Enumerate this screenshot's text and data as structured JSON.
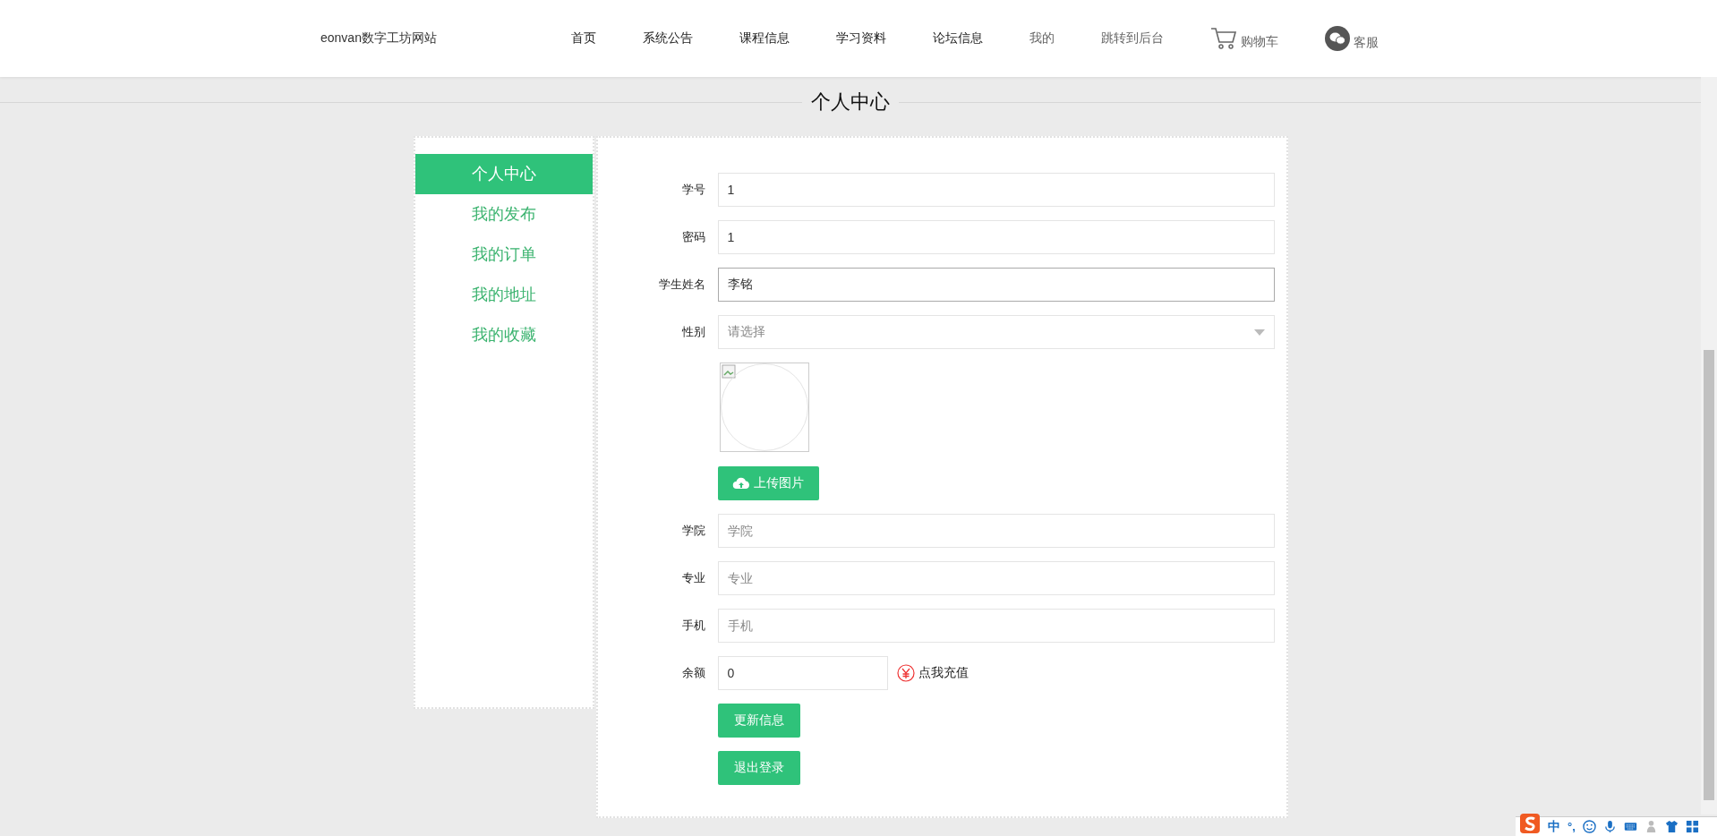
{
  "header": {
    "brand": "eonvan数字工坊网站",
    "nav": [
      {
        "label": "首页",
        "dimmed": false
      },
      {
        "label": "系统公告",
        "dimmed": false
      },
      {
        "label": "课程信息",
        "dimmed": false
      },
      {
        "label": "学习资料",
        "dimmed": false
      },
      {
        "label": "论坛信息",
        "dimmed": false
      },
      {
        "label": "我的",
        "dimmed": true
      },
      {
        "label": "跳转到后台",
        "dimmed": true
      }
    ],
    "cart": "购物车",
    "service": "客服"
  },
  "page_title": "个人中心",
  "sidebar": {
    "items": [
      {
        "label": "个人中心",
        "selected": true
      },
      {
        "label": "我的发布",
        "selected": false
      },
      {
        "label": "我的订单",
        "selected": false
      },
      {
        "label": "我的地址",
        "selected": false
      },
      {
        "label": "我的收藏",
        "selected": false
      }
    ]
  },
  "form": {
    "fields": [
      {
        "kind": "text",
        "label": "学号",
        "value": "1",
        "focused": false
      },
      {
        "kind": "text",
        "label": "密码",
        "value": "1",
        "focused": false
      },
      {
        "kind": "text",
        "label": "学生姓名",
        "value": "李铭",
        "focused": true
      },
      {
        "kind": "select",
        "label": "性别",
        "placeholder": "请选择"
      },
      {
        "kind": "image",
        "button": "上传图片"
      },
      {
        "kind": "text",
        "label": "学院",
        "placeholder": "学院",
        "focused": false
      },
      {
        "kind": "text",
        "label": "专业",
        "placeholder": "专业",
        "focused": false
      },
      {
        "kind": "text",
        "label": "手机",
        "placeholder": "手机",
        "focused": false
      },
      {
        "kind": "balance",
        "label": "余额",
        "value": "0",
        "link": "点我充值"
      }
    ],
    "buttons": [
      "更新信息",
      "退出登录"
    ]
  },
  "ime": {
    "mode": "中",
    "punctuation": "°,"
  }
}
